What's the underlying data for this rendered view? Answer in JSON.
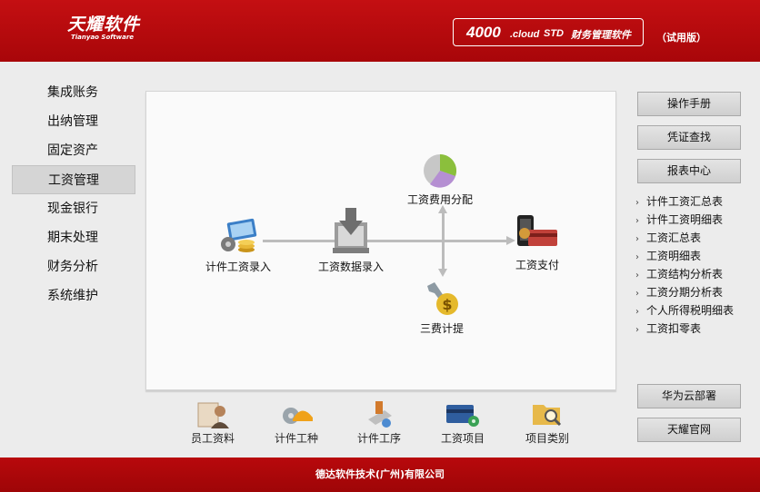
{
  "header": {
    "logo_cn": "天耀软件",
    "logo_en": "Tianyao Software",
    "product_num": "4000",
    "product_cloud": ".cloud",
    "product_std": "STD",
    "product_name": "财务管理软件",
    "trial": "（试用版）"
  },
  "nav": {
    "items": [
      {
        "label": "集成账务"
      },
      {
        "label": "出纳管理"
      },
      {
        "label": "固定资产"
      },
      {
        "label": "工资管理"
      },
      {
        "label": "现金银行"
      },
      {
        "label": "期末处理"
      },
      {
        "label": "财务分析"
      },
      {
        "label": "系统维护"
      }
    ],
    "active": "工资管理"
  },
  "flow": {
    "piece_wage_entry": "计件工资录入",
    "wage_data_entry": "工资数据录入",
    "wage_cost_alloc": "工资费用分配",
    "wage_payment": "工资支付",
    "three_fees": "三费计提"
  },
  "shortcuts": [
    {
      "label": "员工资料",
      "icon": "employee-icon"
    },
    {
      "label": "计件工种",
      "icon": "worker-helmet-icon"
    },
    {
      "label": "计件工序",
      "icon": "process-icon"
    },
    {
      "label": "工资项目",
      "icon": "card-icon"
    },
    {
      "label": "项目类别",
      "icon": "folder-search-icon"
    }
  ],
  "right": {
    "manual": "操作手册",
    "voucher": "凭证查找",
    "report_center": "报表中心",
    "reports": [
      "计件工资汇总表",
      "计件工资明细表",
      "工资汇总表",
      "工资明细表",
      "工资结构分析表",
      "工资分期分析表",
      "个人所得税明细表",
      "工资扣零表"
    ],
    "huawei": "华为云部署",
    "official": "天耀官网"
  },
  "footer": {
    "text": "德达软件技术(广州)有限公司"
  },
  "colors": {
    "brand_red": "#b5090c",
    "panel_bg": "#fafafa",
    "page_bg": "#ececec"
  }
}
